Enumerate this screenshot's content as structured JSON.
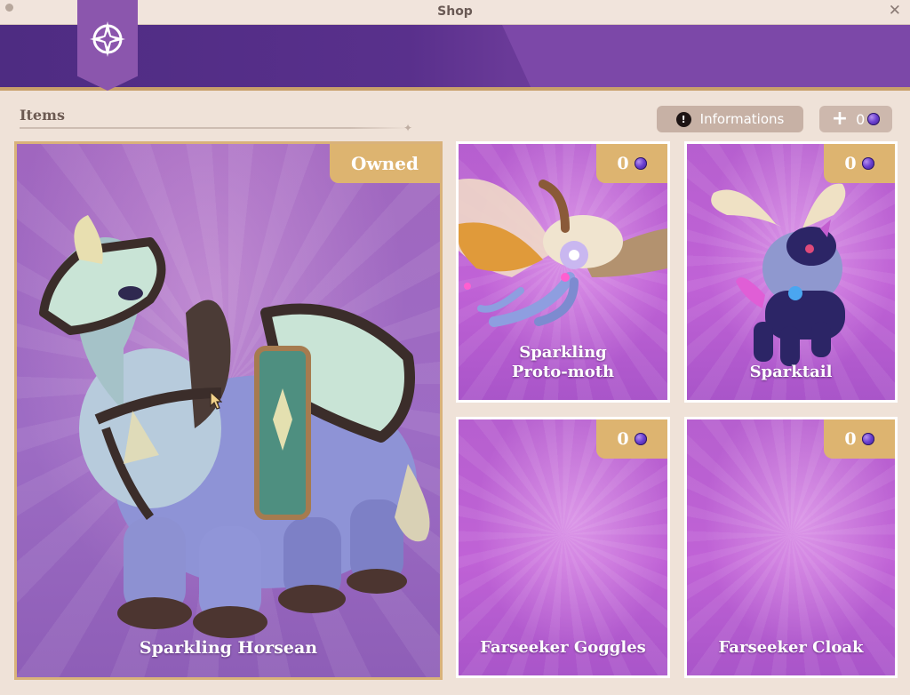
{
  "window": {
    "title": "Shop",
    "close_icon": "close-icon"
  },
  "section": {
    "title": "Items"
  },
  "toolbar": {
    "info_label": "Informations",
    "info_icon": "exclamation-icon",
    "currency_add_icon": "plus-icon",
    "currency_value": "0",
    "currency_icon": "gem-icon"
  },
  "colors": {
    "header_purple": "#59308c",
    "card_purple": "#c062d6",
    "tag_gold": "#ddb470",
    "gem_purple": "#6a3fd0"
  },
  "items": [
    {
      "name": "Sparkling Horsean",
      "status": "Owned"
    },
    {
      "name": "Sparkling Proto-moth",
      "name_line1": "Sparkling",
      "name_line2": "Proto-moth",
      "price": "0"
    },
    {
      "name": "Sparktail",
      "price": "0"
    },
    {
      "name": "Farseeker Goggles",
      "price": "0"
    },
    {
      "name": "Farseeker Cloak",
      "price": "0"
    }
  ]
}
